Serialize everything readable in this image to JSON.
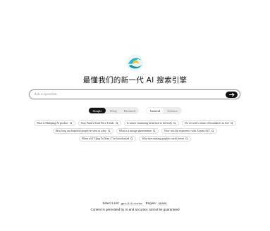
{
  "headline": "最懂我们的新一代 AI 搜索引擎",
  "search": {
    "placeholder": "Ask a question"
  },
  "modes": {
    "options": [
      "Simple",
      "Deep",
      "Research"
    ],
    "selected": "Simple"
  },
  "categories": {
    "options": [
      "General",
      "Science"
    ],
    "selected": "General"
  },
  "suggestions": [
    [
      "What is Mamping AI product",
      "Seay Pams's Send Price Trends",
      "Is winter swimming beneficial to the body",
      "Do we need a sense of boundaries in love"
    ],
    [
      "How long can beautiful people be seen in a day",
      "What is a mirage phenomenon",
      "How was the experience with Xiaomi SU7"
    ],
    [
      "When will \"Qing Yu Nian 2\" be broadcasted",
      "Why does mining graphics cards freeze"
    ]
  ],
  "footer": {
    "llm_label": "Select LLM:",
    "llm_value": "gpt-3.5-turbo",
    "engine_label": "Engine:",
    "engine_value": "SEARX",
    "disclaimer": "Content is generated by AI and accuracy cannot be guaranteed"
  },
  "colors": {
    "primary": "#151515",
    "logo_teal": "#2bb7c6",
    "logo_yellow": "#f4c22b"
  }
}
